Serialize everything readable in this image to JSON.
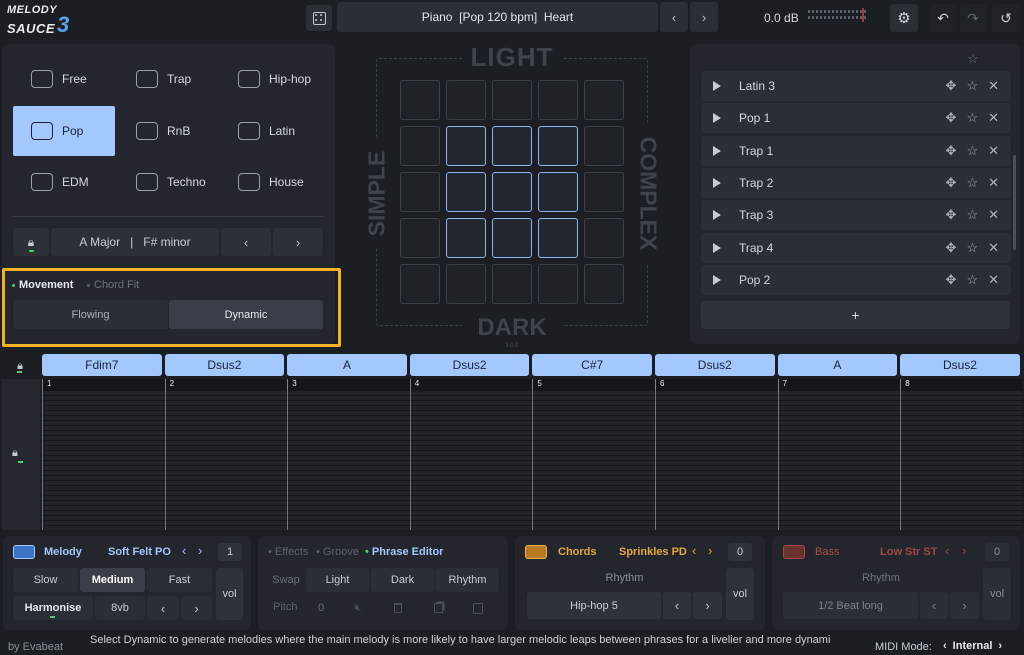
{
  "app": {
    "logo_line1": "MELODY",
    "logo_line2": "SAUCE",
    "logo_num": "3",
    "credit": "by Evabeat"
  },
  "header": {
    "preset": "Piano  [Pop 120 bpm]  Heart",
    "volume": "0.0 dB"
  },
  "genres": [
    {
      "label": "Free",
      "icon": "infinity-icon"
    },
    {
      "label": "Trap",
      "icon": "hooded-figure-icon"
    },
    {
      "label": "Hip-hop",
      "icon": "boombox-icon"
    },
    {
      "label": "Pop",
      "icon": "microphone-icon",
      "selected": true
    },
    {
      "label": "RnB",
      "icon": "vinyl-icon"
    },
    {
      "label": "Latin",
      "icon": "speaker-icon"
    },
    {
      "label": "EDM",
      "icon": "mixer-icon"
    },
    {
      "label": "Techno",
      "icon": "atom-icon"
    },
    {
      "label": "House",
      "icon": "piano-icon"
    }
  ],
  "key": {
    "major": "A Major",
    "minor": "F# minor"
  },
  "mode_tabs": {
    "movement": "Movement",
    "chord_fit": "Chord Fit",
    "flowing": "Flowing",
    "dynamic": "Dynamic"
  },
  "grid": {
    "top": "LIGHT",
    "bottom": "DARK",
    "left": "SIMPLE",
    "right": "COMPLEX",
    "version": "3.0.0"
  },
  "presets": [
    "Latin 3",
    "Pop 1",
    "Trap 1",
    "Trap 2",
    "Trap 3",
    "Trap 4",
    "Pop 2"
  ],
  "add_label": "+",
  "chords": [
    "Fdim7",
    "Dsus2",
    "A",
    "Dsus2",
    "C#7",
    "Dsus2",
    "A",
    "Dsus2"
  ],
  "bars": [
    "1",
    "2",
    "3",
    "4",
    "5",
    "6",
    "7",
    "8"
  ],
  "melody": {
    "title": "Melody",
    "instrument": "Soft Felt PO",
    "octave": "1",
    "slow": "Slow",
    "medium": "Medium",
    "fast": "Fast",
    "vol": "vol",
    "harmonise": "Harmonise",
    "octave_shift": "8vb"
  },
  "phrase": {
    "effects": "Effects",
    "groove": "Groove",
    "editor": "Phrase Editor",
    "swap": "Swap",
    "light": "Light",
    "dark": "Dark",
    "rhythm": "Rhythm",
    "pitch": "Pitch",
    "pitch_val": "0"
  },
  "chords_panel": {
    "title": "Chords",
    "instrument": "Sprinkles PD",
    "octave": "0",
    "rhythm_label": "Rhythm",
    "rhythm": "Hip-hop 5",
    "vol": "vol"
  },
  "bass": {
    "title": "Bass",
    "instrument": "Low Str ST",
    "octave": "0",
    "rhythm_label": "Rhythm",
    "rhythm": "1/2 Beat long",
    "vol": "vol"
  },
  "status": {
    "hint": "Select Dynamic to generate melodies where the main melody is more likely to have larger melodic leaps between phrases for a livelier and more dynamic feel.",
    "midi_label": "MIDI Mode:",
    "midi_value": "Internal"
  },
  "colors": {
    "accent": "#a3c8ff",
    "highlight": "#f5b324",
    "chords": "#e8a33a",
    "bass": "#b04a45"
  }
}
